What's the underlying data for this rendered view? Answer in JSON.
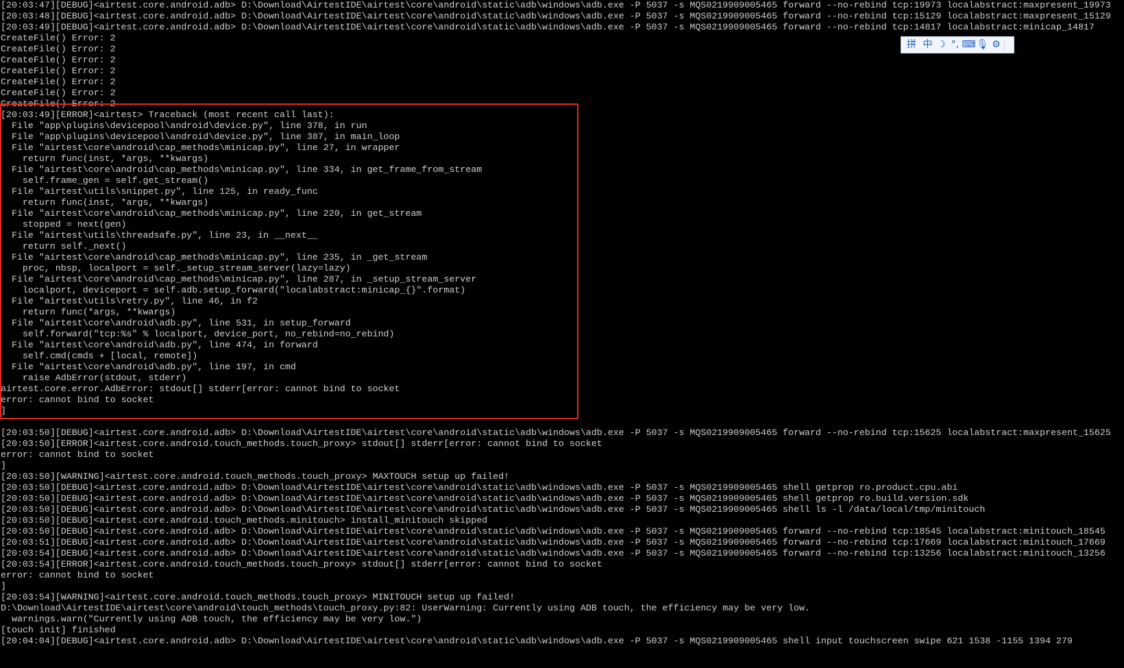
{
  "terminal": {
    "lines": [
      "[20:03:47][DEBUG]<airtest.core.android.adb> D:\\Download\\AirtestIDE\\airtest\\core\\android\\static\\adb\\windows\\adb.exe -P 5037 -s MQS0219909005465 forward --no-rebind tcp:19973 localabstract:maxpresent_19973",
      "[20:03:48][DEBUG]<airtest.core.android.adb> D:\\Download\\AirtestIDE\\airtest\\core\\android\\static\\adb\\windows\\adb.exe -P 5037 -s MQS0219909005465 forward --no-rebind tcp:15129 localabstract:maxpresent_15129",
      "[20:03:49][DEBUG]<airtest.core.android.adb> D:\\Download\\AirtestIDE\\airtest\\core\\android\\static\\adb\\windows\\adb.exe -P 5037 -s MQS0219909005465 forward --no-rebind tcp:14817 localabstract:minicap_14817",
      "CreateFile() Error: 2",
      "CreateFile() Error: 2",
      "CreateFile() Error: 2",
      "CreateFile() Error: 2",
      "CreateFile() Error: 2",
      "CreateFile() Error: 2",
      "CreateFile() Error: 2",
      "[20:03:49][ERROR]<airtest> Traceback (most recent call last):",
      "  File \"app\\plugins\\devicepool\\android\\device.py\", line 378, in run",
      "  File \"app\\plugins\\devicepool\\android\\device.py\", line 387, in main_loop",
      "  File \"airtest\\core\\android\\cap_methods\\minicap.py\", line 27, in wrapper",
      "    return func(inst, *args, **kwargs)",
      "  File \"airtest\\core\\android\\cap_methods\\minicap.py\", line 334, in get_frame_from_stream",
      "    self.frame_gen = self.get_stream()",
      "  File \"airtest\\utils\\snippet.py\", line 125, in ready_func",
      "    return func(inst, *args, **kwargs)",
      "  File \"airtest\\core\\android\\cap_methods\\minicap.py\", line 220, in get_stream",
      "    stopped = next(gen)",
      "  File \"airtest\\utils\\threadsafe.py\", line 23, in __next__",
      "    return self._next()",
      "  File \"airtest\\core\\android\\cap_methods\\minicap.py\", line 235, in _get_stream",
      "    proc, nbsp, localport = self._setup_stream_server(lazy=lazy)",
      "  File \"airtest\\core\\android\\cap_methods\\minicap.py\", line 287, in _setup_stream_server",
      "    localport, deviceport = self.adb.setup_forward(\"localabstract:minicap_{}\".format)",
      "  File \"airtest\\utils\\retry.py\", line 46, in f2",
      "    return func(*args, **kwargs)",
      "  File \"airtest\\core\\android\\adb.py\", line 531, in setup_forward",
      "    self.forward(\"tcp:%s\" % localport, device_port, no_rebind=no_rebind)",
      "  File \"airtest\\core\\android\\adb.py\", line 474, in forward",
      "    self.cmd(cmds + [local, remote])",
      "  File \"airtest\\core\\android\\adb.py\", line 197, in cmd",
      "    raise AdbError(stdout, stderr)",
      "airtest.core.error.AdbError: stdout[] stderr[error: cannot bind to socket",
      "error: cannot bind to socket",
      "]",
      "",
      "[20:03:50][DEBUG]<airtest.core.android.adb> D:\\Download\\AirtestIDE\\airtest\\core\\android\\static\\adb\\windows\\adb.exe -P 5037 -s MQS0219909005465 forward --no-rebind tcp:15625 localabstract:maxpresent_15625",
      "[20:03:50][ERROR]<airtest.core.android.touch_methods.touch_proxy> stdout[] stderr[error: cannot bind to socket",
      "error: cannot bind to socket",
      "]",
      "[20:03:50][WARNING]<airtest.core.android.touch_methods.touch_proxy> MAXTOUCH setup up failed!",
      "[20:03:50][DEBUG]<airtest.core.android.adb> D:\\Download\\AirtestIDE\\airtest\\core\\android\\static\\adb\\windows\\adb.exe -P 5037 -s MQS0219909005465 shell getprop ro.product.cpu.abi",
      "[20:03:50][DEBUG]<airtest.core.android.adb> D:\\Download\\AirtestIDE\\airtest\\core\\android\\static\\adb\\windows\\adb.exe -P 5037 -s MQS0219909005465 shell getprop ro.build.version.sdk",
      "[20:03:50][DEBUG]<airtest.core.android.adb> D:\\Download\\AirtestIDE\\airtest\\core\\android\\static\\adb\\windows\\adb.exe -P 5037 -s MQS0219909005465 shell ls -l /data/local/tmp/minitouch",
      "[20:03:50][DEBUG]<airtest.core.android.touch_methods.minitouch> install_minitouch skipped",
      "[20:03:50][DEBUG]<airtest.core.android.adb> D:\\Download\\AirtestIDE\\airtest\\core\\android\\static\\adb\\windows\\adb.exe -P 5037 -s MQS0219909005465 forward --no-rebind tcp:18545 localabstract:minitouch_18545",
      "[20:03:51][DEBUG]<airtest.core.android.adb> D:\\Download\\AirtestIDE\\airtest\\core\\android\\static\\adb\\windows\\adb.exe -P 5037 -s MQS0219909005465 forward --no-rebind tcp:17669 localabstract:minitouch_17669",
      "[20:03:54][DEBUG]<airtest.core.android.adb> D:\\Download\\AirtestIDE\\airtest\\core\\android\\static\\adb\\windows\\adb.exe -P 5037 -s MQS0219909005465 forward --no-rebind tcp:13256 localabstract:minitouch_13256",
      "[20:03:54][ERROR]<airtest.core.android.touch_methods.touch_proxy> stdout[] stderr[error: cannot bind to socket",
      "error: cannot bind to socket",
      "]",
      "[20:03:54][WARNING]<airtest.core.android.touch_methods.touch_proxy> MINITOUCH setup up failed!",
      "D:\\Download\\AirtestIDE\\airtest\\core\\android\\touch_methods\\touch_proxy.py:82: UserWarning: Currently using ADB touch, the efficiency may be very low.",
      "  warnings.warn(\"Currently using ADB touch, the efficiency may be very low.\")",
      "[touch init] finished",
      "[20:04:04][DEBUG]<airtest.core.android.adb> D:\\Download\\AirtestIDE\\airtest\\core\\android\\static\\adb\\windows\\adb.exe -P 5037 -s MQS0219909005465 shell input touchscreen swipe 621 1538 -1155 1394 279"
    ]
  },
  "ime_toolbar": {
    "logo_glyph": "拼",
    "mode_label": "中",
    "items": [
      {
        "name": "half-moon-icon",
        "glyph": "☽"
      },
      {
        "name": "punctuation-icon",
        "glyph": "°,"
      },
      {
        "name": "keyboard-icon",
        "glyph": "⌨"
      },
      {
        "name": "microphone-icon",
        "glyph": "🎙"
      },
      {
        "name": "settings-gear-icon",
        "glyph": "⚙"
      }
    ],
    "accent_color": "#1b5fc2"
  },
  "highlight": {
    "color": "#e8281f"
  }
}
